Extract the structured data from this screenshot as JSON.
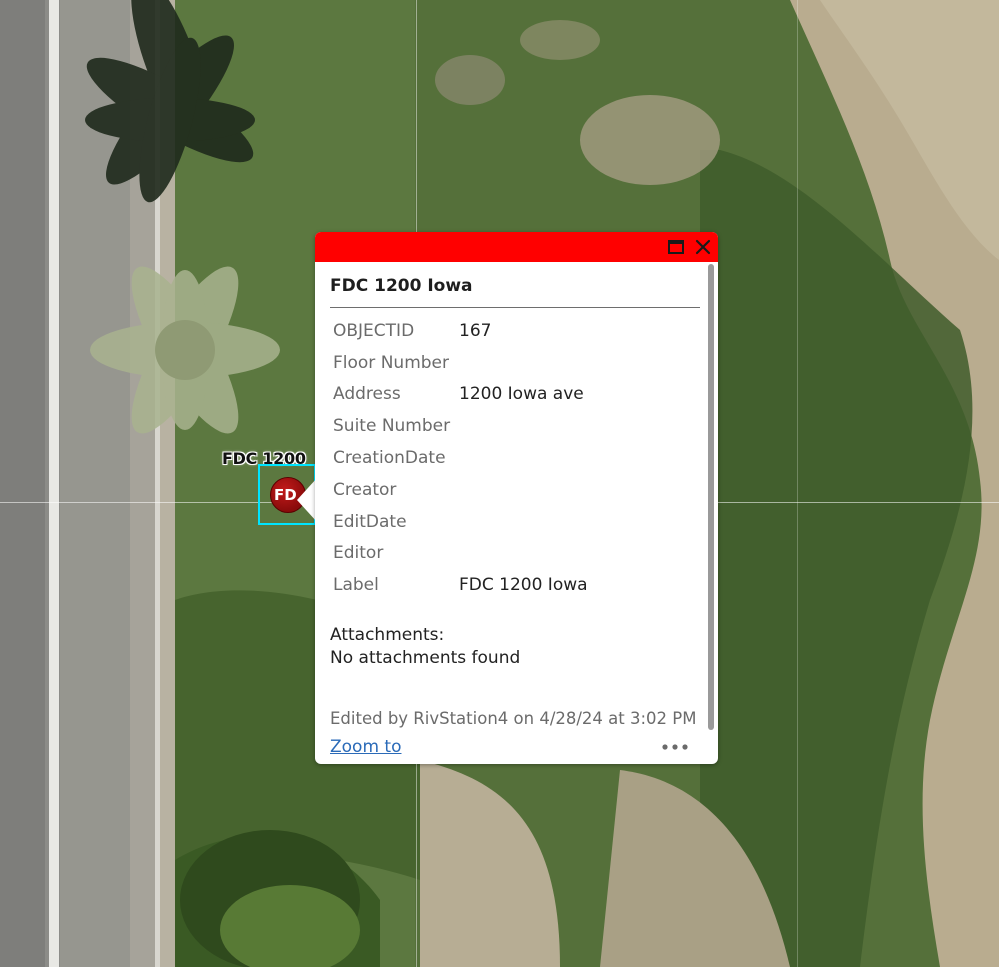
{
  "map": {
    "feature_label": "FDC 1200",
    "marker_text": "FD"
  },
  "popup": {
    "title": "FDC 1200 Iowa",
    "header_color": "#ff0000",
    "fields": [
      {
        "name": "OBJECTID",
        "value": "167"
      },
      {
        "name": "Floor Number",
        "value": ""
      },
      {
        "name": "Address",
        "value": "1200 Iowa ave"
      },
      {
        "name": "Suite Number",
        "value": ""
      },
      {
        "name": "CreationDate",
        "value": ""
      },
      {
        "name": "Creator",
        "value": ""
      },
      {
        "name": "EditDate",
        "value": ""
      },
      {
        "name": "Editor",
        "value": ""
      },
      {
        "name": "Label",
        "value": "FDC 1200 Iowa"
      }
    ],
    "attachments_label": "Attachments:",
    "attachments_empty": "No attachments found",
    "edited_text": "Edited by RivStation4 on 4/28/24 at 3:02 PM",
    "zoom_to_label": "Zoom to",
    "icons": {
      "maximize": "maximize-icon",
      "close": "close-icon",
      "more": "more-options-icon"
    }
  }
}
